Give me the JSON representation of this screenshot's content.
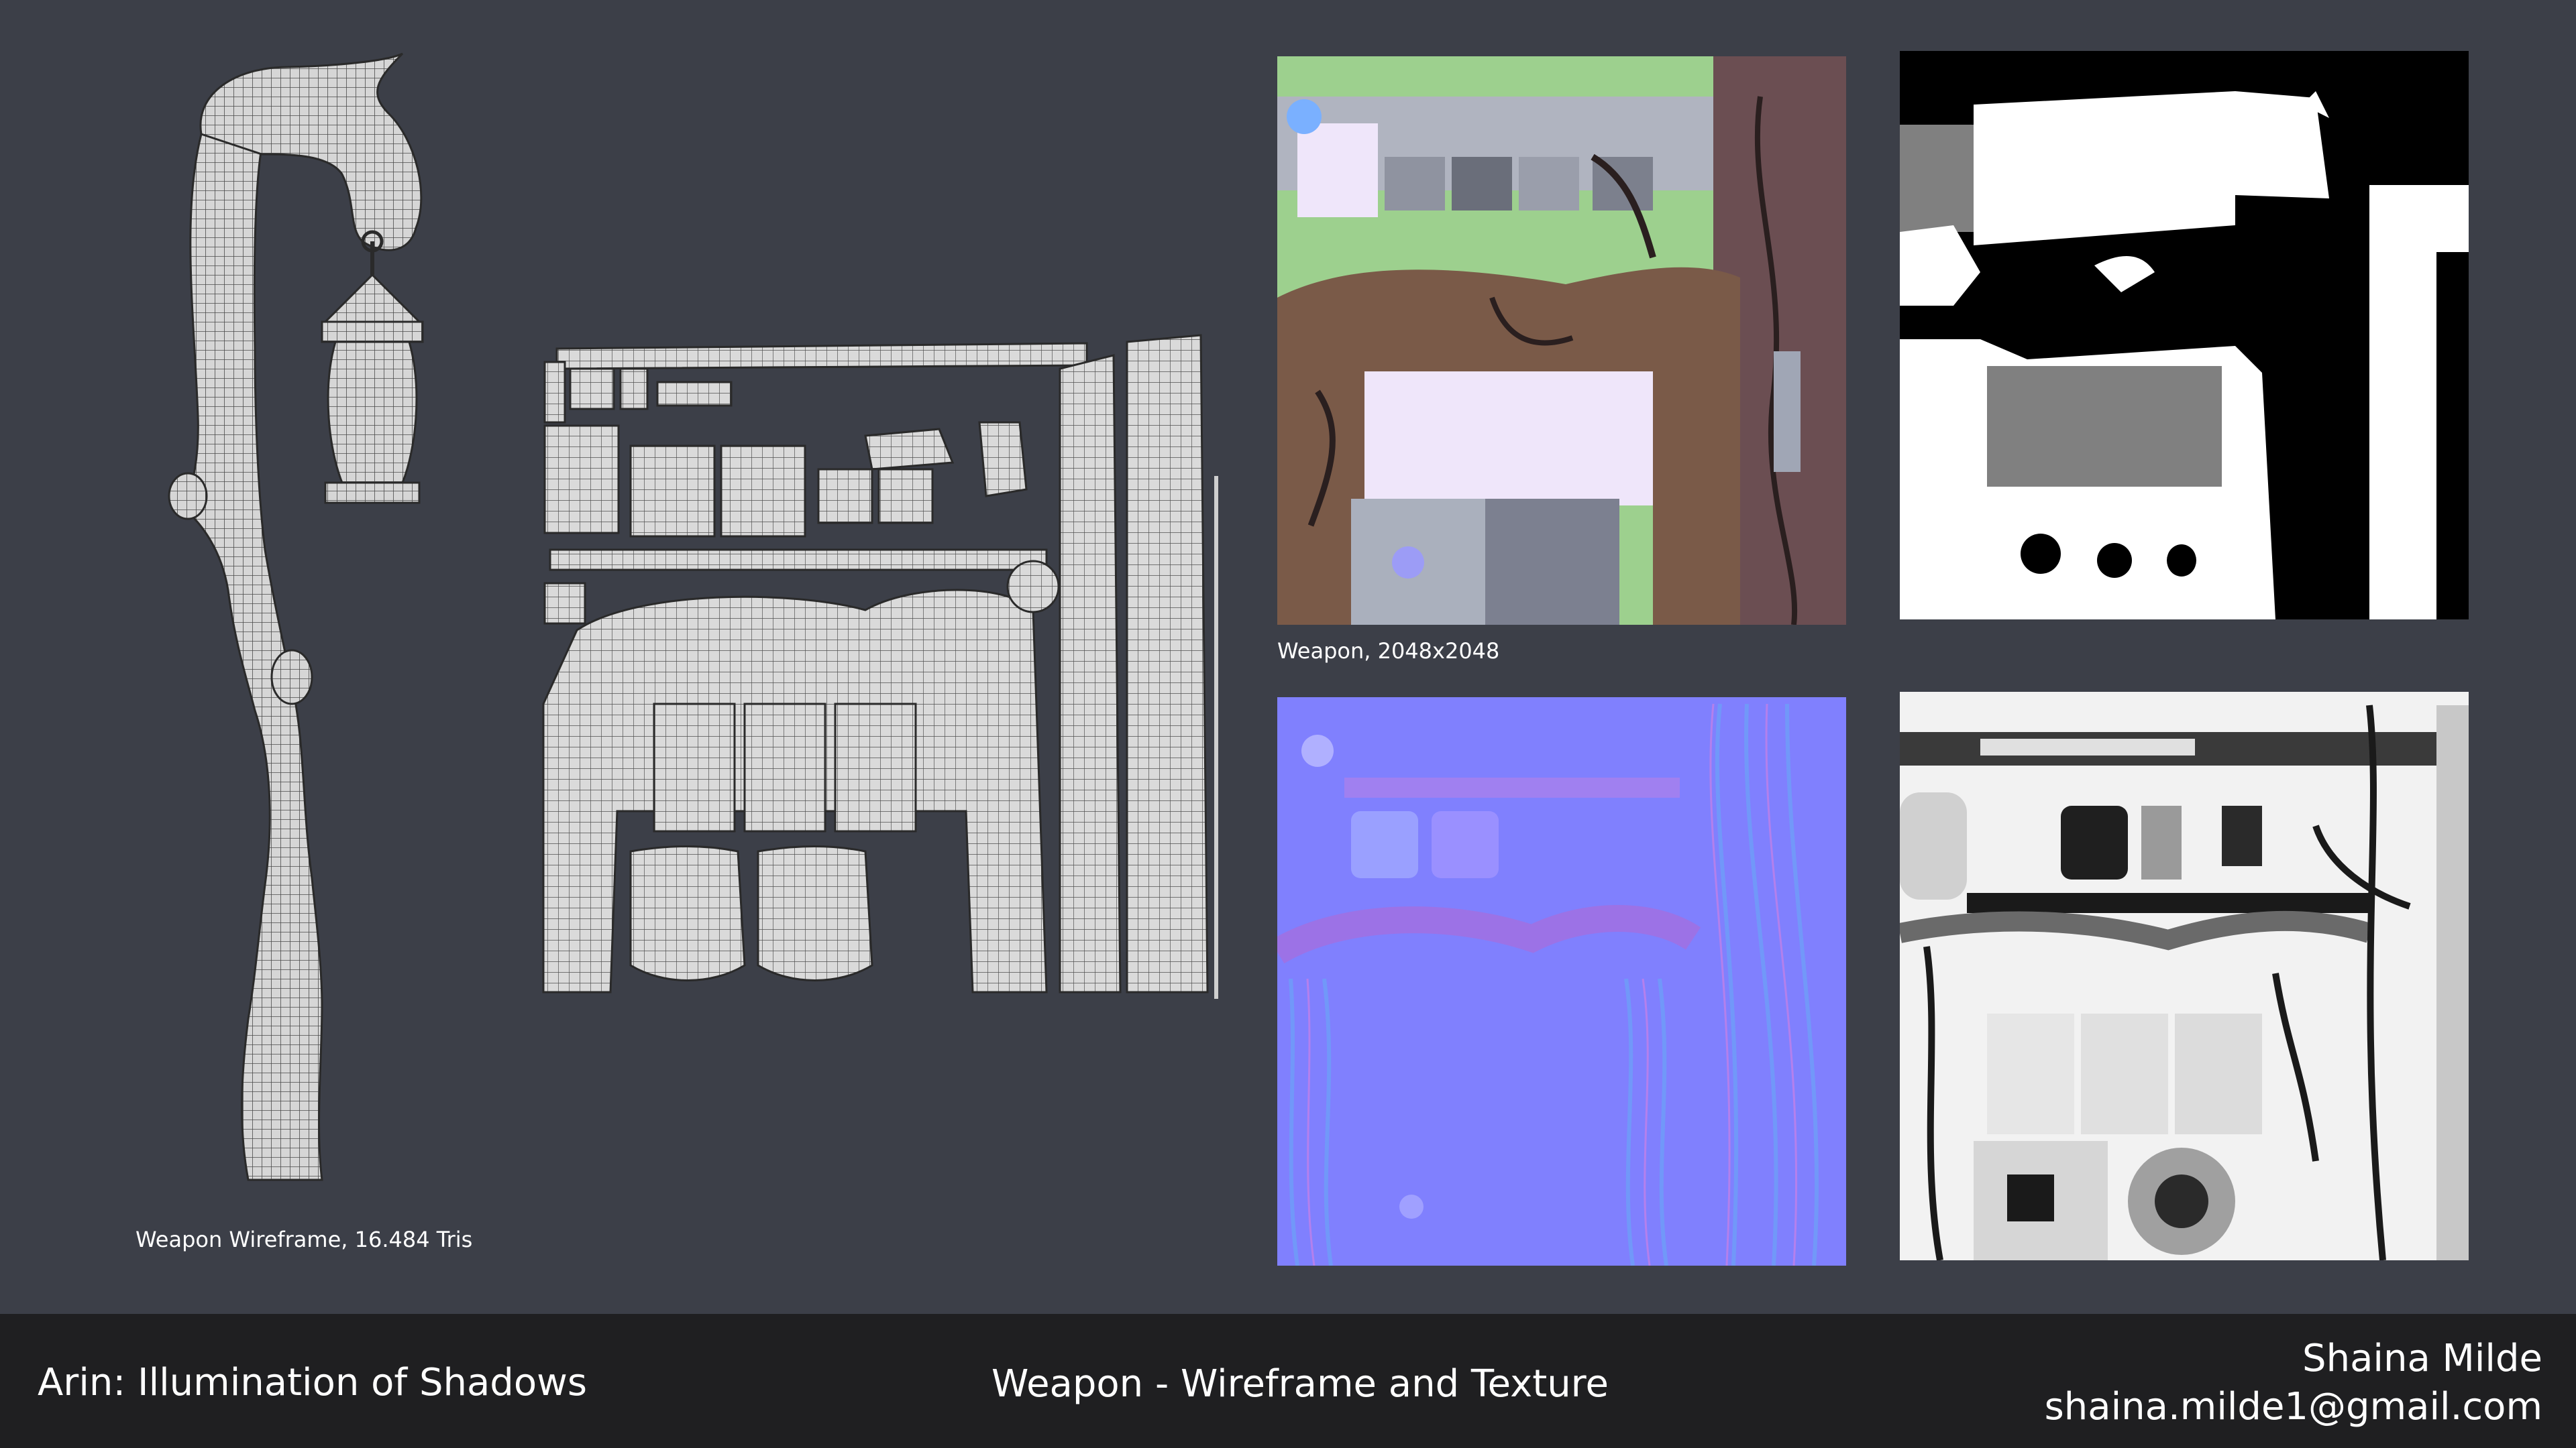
{
  "captions": {
    "wireframe": "Weapon Wireframe, 16.484 Tris",
    "texture": "Weapon, 2048x2048"
  },
  "footer": {
    "project_title": "Arin: Illumination of Shadows",
    "section_title": "Weapon - Wireframe and Texture",
    "author_name": "Shaina Milde",
    "author_email": "shaina.milde1@gmail.com"
  },
  "colors": {
    "background": "#3c3f48",
    "footer_bg": "#1f1f21",
    "wire_fill": "#d9d9d9",
    "wire_line": "#3a3a3a",
    "albedo_green": "#9dd08e",
    "albedo_wood": "#7a5a48",
    "albedo_stone": "#a9aebc",
    "albedo_glow": "#efe6fa",
    "normal_base": "#8080fe",
    "mask_black": "#000000",
    "mask_white": "#ffffff",
    "mask_gray": "#808080",
    "ao_white": "#f2f2f2"
  }
}
